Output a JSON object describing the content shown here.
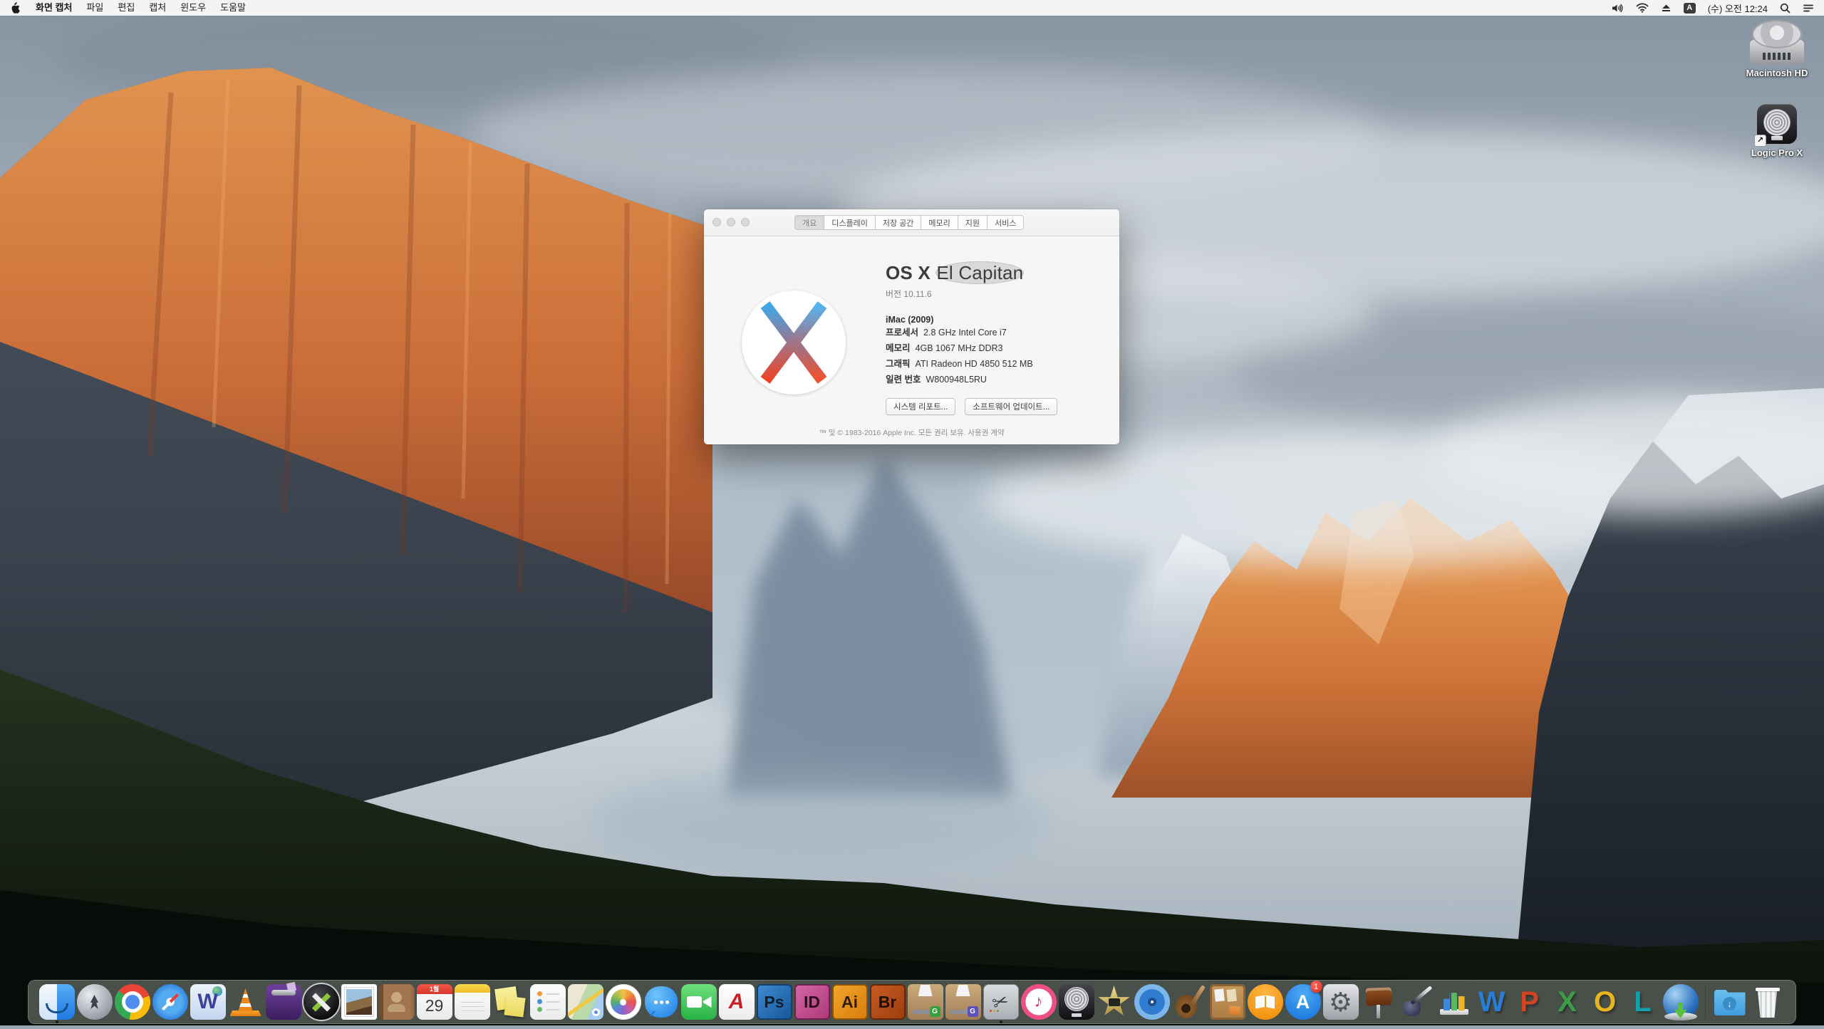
{
  "menu_bar": {
    "app_name": "화면 캡처",
    "menus": [
      "파일",
      "편집",
      "캡처",
      "윈도우",
      "도움말"
    ],
    "status": {
      "icons": [
        "volume-icon",
        "wifi-icon",
        "eject-icon",
        "input-source-badge",
        "spotlight-icon",
        "notification-center-icon"
      ],
      "input_source_label": "A",
      "clock": "(수) 오전 12:24"
    }
  },
  "about_window": {
    "tabs": [
      "개요",
      "디스플레이",
      "저장 공간",
      "메모리",
      "지원",
      "서비스"
    ],
    "selected_tab": "개요",
    "title_strong": "OS X",
    "title_light": "El Capitan",
    "version": "버전 10.11.6",
    "model": "iMac (2009)",
    "specs": [
      {
        "label": "프로세서",
        "value": "2.8 GHz Intel Core i7"
      },
      {
        "label": "메모리",
        "value": "4GB 1067 MHz DDR3"
      },
      {
        "label": "그래픽",
        "value": "ATI Radeon HD 4850 512 MB"
      },
      {
        "label": "일련 번호",
        "value": "W800948L5RU"
      }
    ],
    "buttons": {
      "system_report": "시스템 리포트...",
      "software_update": "소프트웨어 업데이트..."
    },
    "footer": "™ 및 © 1983-2016 Apple Inc. 모든 권리 보유. 사용권 계약",
    "logo_colors": {
      "blue": "#3fa9ea",
      "red": "#f1512a"
    }
  },
  "desktop_icons": [
    {
      "label": "Macintosh HD"
    },
    {
      "label": "Logic Pro X"
    }
  ],
  "dock": {
    "items": [
      {
        "icon": "finder",
        "running": true
      },
      {
        "icon": "launchpad"
      },
      {
        "icon": "chrome"
      },
      {
        "icon": "safari"
      },
      {
        "icon": "w-globe-app",
        "glyph": "W"
      },
      {
        "icon": "vlc"
      },
      {
        "icon": "toast"
      },
      {
        "icon": "x-converter"
      },
      {
        "icon": "mail"
      },
      {
        "icon": "contacts"
      },
      {
        "icon": "calendar",
        "month": "1월",
        "day": "29"
      },
      {
        "icon": "notes"
      },
      {
        "icon": "stickies"
      },
      {
        "icon": "reminders"
      },
      {
        "icon": "maps"
      },
      {
        "icon": "photos"
      },
      {
        "icon": "messages"
      },
      {
        "icon": "facetime"
      },
      {
        "icon": "acrobat",
        "glyph": "A"
      },
      {
        "icon": "photoshop",
        "glyph": "Ps"
      },
      {
        "icon": "indesign",
        "glyph": "ID"
      },
      {
        "icon": "illustrator",
        "glyph": "Ai"
      },
      {
        "icon": "bridge",
        "glyph": "Br"
      },
      {
        "icon": "stuffit-green",
        "glyph": "G"
      },
      {
        "icon": "stuffit-purple",
        "glyph": "G"
      },
      {
        "icon": "screen-capture",
        "running": true
      },
      {
        "icon": "itunes"
      },
      {
        "icon": "logic-pro"
      },
      {
        "icon": "imovie"
      },
      {
        "icon": "dvd-player"
      },
      {
        "icon": "garageband"
      },
      {
        "icon": "corkboard"
      },
      {
        "icon": "ibooks"
      },
      {
        "icon": "app-store",
        "glyph": "A",
        "badge": "1"
      },
      {
        "icon": "system-preferences"
      },
      {
        "icon": "keynote"
      },
      {
        "icon": "pages"
      },
      {
        "icon": "numbers"
      },
      {
        "icon": "word",
        "glyph": "W"
      },
      {
        "icon": "powerpoint",
        "glyph": "P"
      },
      {
        "icon": "excel",
        "glyph": "X"
      },
      {
        "icon": "outlook",
        "glyph": "O"
      },
      {
        "icon": "lync",
        "glyph": "L"
      },
      {
        "icon": "downloader"
      },
      {
        "type": "separator"
      },
      {
        "icon": "downloads-folder"
      },
      {
        "icon": "trash"
      }
    ],
    "app_store_badge": "1"
  }
}
